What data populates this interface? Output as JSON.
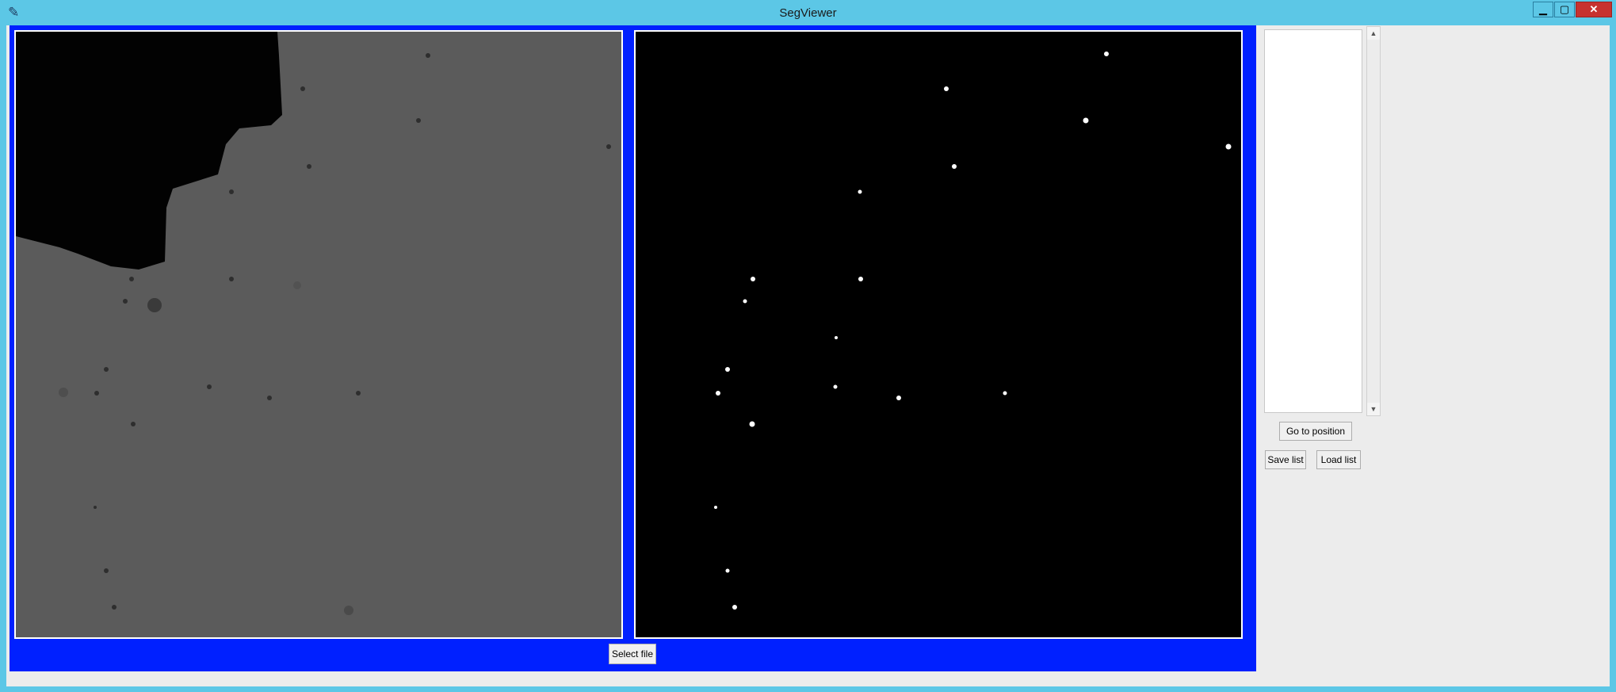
{
  "window": {
    "title": "SegViewer",
    "icon": "feather-icon",
    "controls": {
      "minimize": "▁",
      "maximize": "▢",
      "close": "✕"
    }
  },
  "buttons": {
    "select_file": "Select file",
    "go_to_position": "Go to position",
    "save_list": "Save list",
    "load_list": "Load list"
  },
  "listbox": {
    "items": []
  },
  "colors": {
    "title_bar": "#5cc7e6",
    "frame": "#0020ff",
    "background": "#ececec",
    "close": "#c7322f"
  },
  "images": {
    "left": "grayscale microscopy image",
    "right": "binary segmentation mask"
  }
}
